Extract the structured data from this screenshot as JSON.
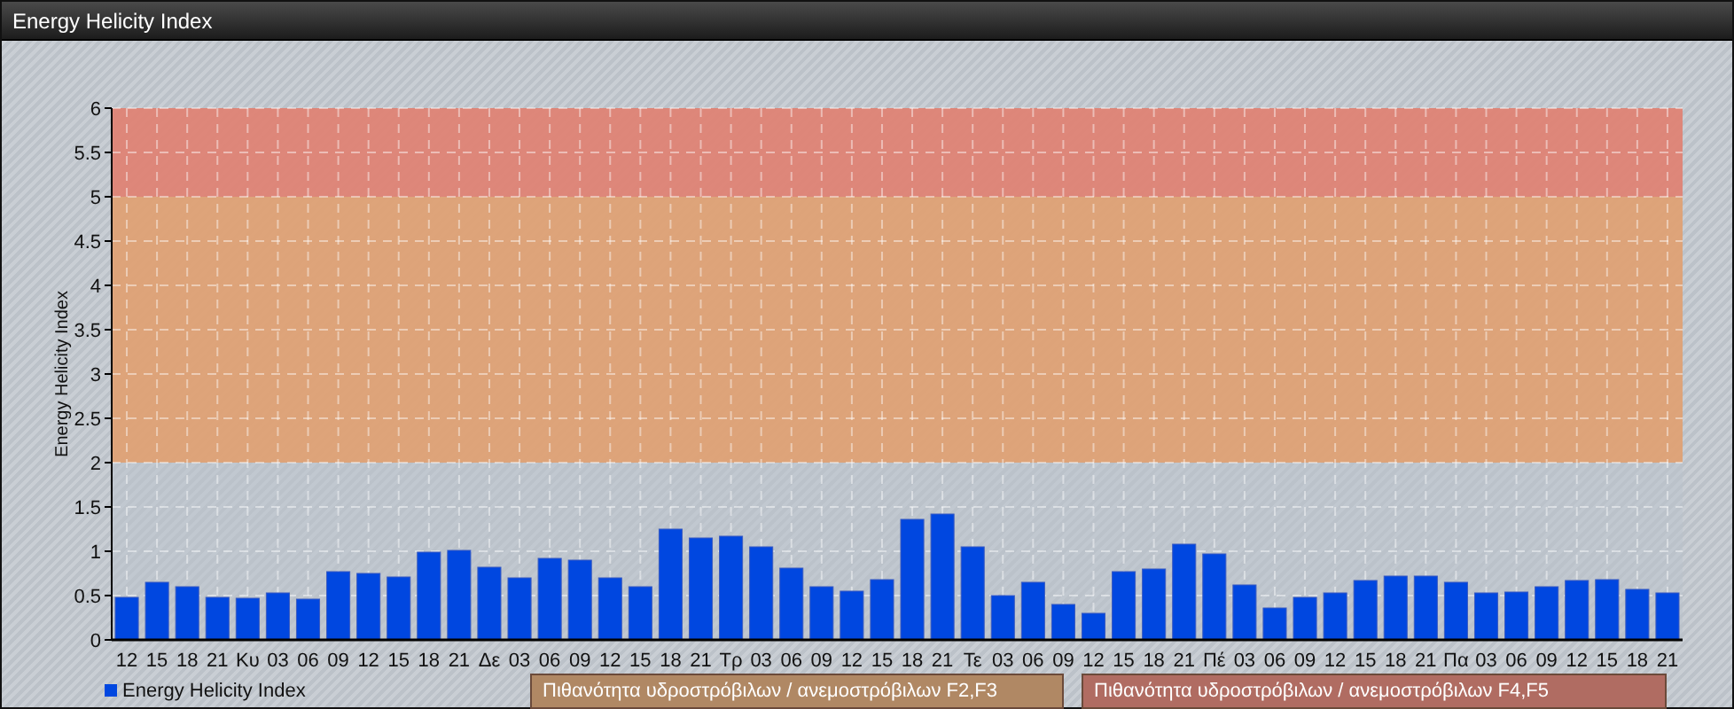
{
  "window": {
    "title": "Energy Helicity Index"
  },
  "chart": {
    "chart_data": {
      "type": "bar",
      "ylabel": "Energy Helicity Index",
      "categories": [
        "12",
        "15",
        "18",
        "21",
        "Κυ",
        "03",
        "06",
        "09",
        "12",
        "15",
        "18",
        "21",
        "Δε",
        "03",
        "06",
        "09",
        "12",
        "15",
        "18",
        "21",
        "Τρ",
        "03",
        "06",
        "09",
        "12",
        "15",
        "18",
        "21",
        "Τε",
        "03",
        "06",
        "09",
        "12",
        "15",
        "18",
        "21",
        "Πέ",
        "03",
        "06",
        "09",
        "12",
        "15",
        "18",
        "21",
        "Πα",
        "03",
        "06",
        "09",
        "12",
        "15",
        "18",
        "21"
      ],
      "series": [
        {
          "name": "Energy Helicity Index",
          "color": "#0047e0",
          "values": [
            0.48,
            0.65,
            0.6,
            0.48,
            0.47,
            0.53,
            0.46,
            0.77,
            0.75,
            0.71,
            0.99,
            1.01,
            0.82,
            0.7,
            0.92,
            0.9,
            0.7,
            0.6,
            1.25,
            1.15,
            1.17,
            1.05,
            0.81,
            0.6,
            0.55,
            0.68,
            1.36,
            1.42,
            1.05,
            0.5,
            0.65,
            0.4,
            0.3,
            0.77,
            0.8,
            1.08,
            0.97,
            0.62,
            0.36,
            0.48,
            0.53,
            0.67,
            0.72,
            0.72,
            0.65,
            0.53,
            0.54,
            0.6,
            0.67,
            0.68,
            0.57,
            0.53
          ]
        }
      ],
      "ylim": [
        0,
        6
      ],
      "yticks": [
        0,
        0.5,
        1,
        1.5,
        2,
        2.5,
        3,
        3.5,
        4,
        4.5,
        5,
        5.5,
        6
      ],
      "grid": true,
      "bands": [
        {
          "axis": "y",
          "from": 0,
          "to": 2,
          "color": "#b9c1cc"
        },
        {
          "axis": "y",
          "from": 2,
          "to": 5,
          "color": "#e0a070"
        },
        {
          "axis": "y",
          "from": 5,
          "to": 6,
          "color": "#e08070"
        }
      ]
    }
  },
  "band_legend": [
    {
      "label": "Πιθανότητα υδροστρόβιλων / ανεμοστρόβιλων F2,F3",
      "color": "#b08864"
    },
    {
      "label": "Πιθανότητα υδροστρόβιλων / ανεμοστρόβιλων F4,F5",
      "color": "#b06c62"
    }
  ]
}
